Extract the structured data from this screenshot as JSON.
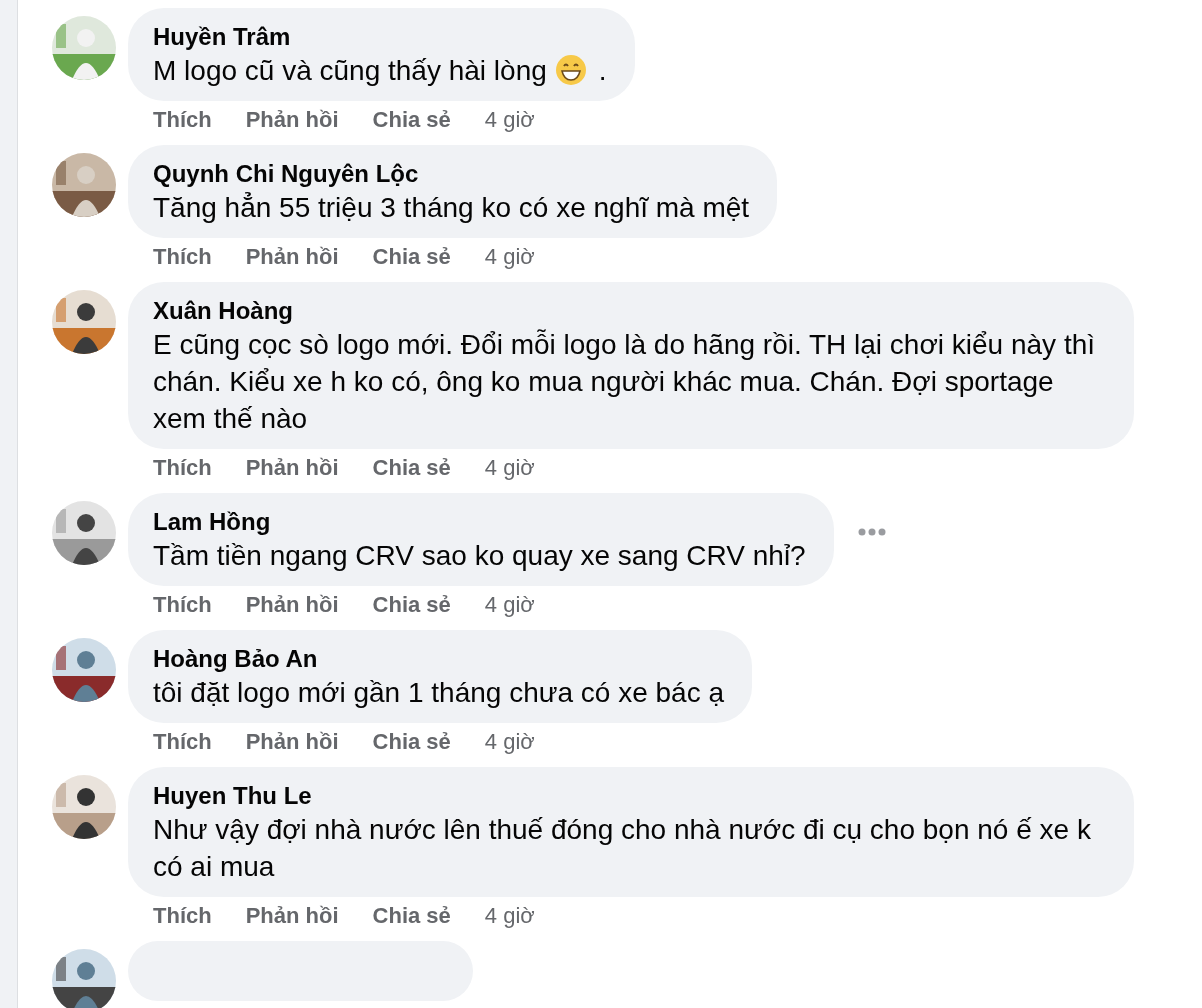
{
  "comments": [
    {
      "author": "Huyền Trâm",
      "text": "M logo cũ và cũng thấy hài lòng",
      "emoji": true,
      "trailing": ".",
      "actions": [
        "Thích",
        "Phản hồi",
        "Chia sẻ"
      ],
      "time": "4 giờ",
      "menu": false
    },
    {
      "author": "Quynh Chi Nguyên Lộc",
      "text": "Tăng hẳn 55 triệu 3 tháng ko có xe nghĩ mà mệt",
      "emoji": false,
      "actions": [
        "Thích",
        "Phản hồi",
        "Chia sẻ"
      ],
      "time": "4 giờ",
      "menu": false
    },
    {
      "author": "Xuân Hoàng",
      "text": "E cũng cọc sò logo mới. Đổi mỗi logo là do hãng rồi. TH lại chơi kiểu này thì chán. Kiểu xe h ko có, ông ko mua người khác mua. Chán. Đợi sportage xem thế nào",
      "emoji": false,
      "actions": [
        "Thích",
        "Phản hồi",
        "Chia sẻ"
      ],
      "time": "4 giờ",
      "menu": false
    },
    {
      "author": "Lam Hồng",
      "text": "Tầm tiền ngang CRV sao ko quay xe sang CRV nhỉ?",
      "emoji": false,
      "actions": [
        "Thích",
        "Phản hồi",
        "Chia sẻ"
      ],
      "time": "4 giờ",
      "menu": true
    },
    {
      "author": "Hoàng Bảo An",
      "text": "tôi đặt logo mới gần 1 tháng chưa có xe bác ạ",
      "emoji": false,
      "actions": [
        "Thích",
        "Phản hồi",
        "Chia sẻ"
      ],
      "time": "4 giờ",
      "menu": false
    },
    {
      "author": "Huyen Thu Le",
      "text": "Như vậy đợi nhà nước lên thuế đóng cho nhà nước đi cụ cho bọn nó ế xe k có ai mua",
      "emoji": false,
      "actions": [
        "Thích",
        "Phản hồi",
        "Chia sẻ"
      ],
      "time": "4 giờ",
      "menu": false
    }
  ]
}
